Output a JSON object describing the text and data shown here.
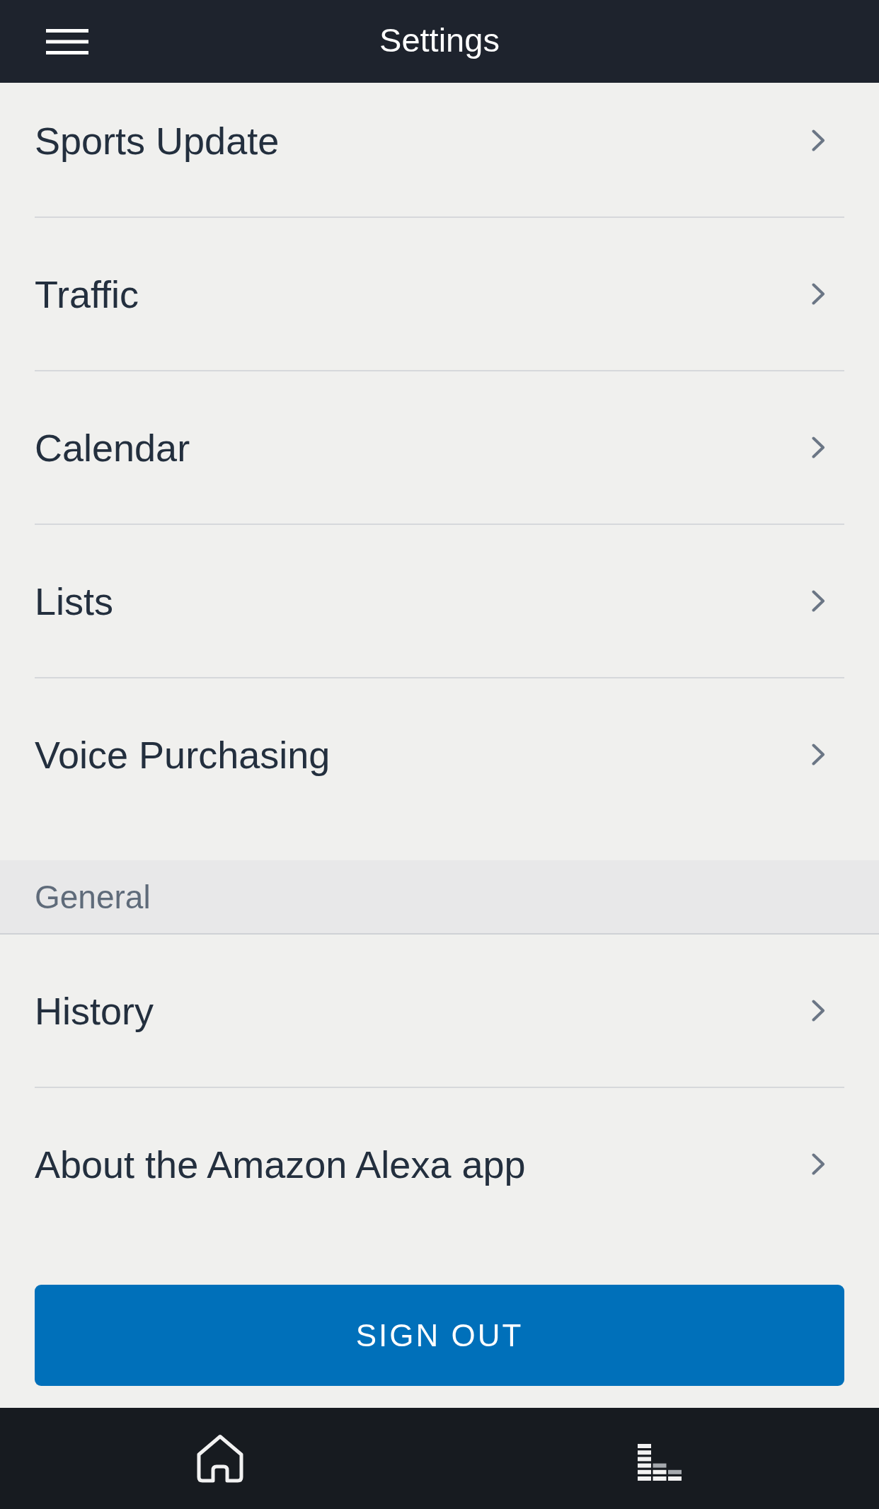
{
  "top_bar": {
    "title": "Settings"
  },
  "sections": [
    {
      "items": [
        {
          "label": "Sports Update"
        },
        {
          "label": "Traffic"
        },
        {
          "label": "Calendar"
        },
        {
          "label": "Lists"
        },
        {
          "label": "Voice Purchasing"
        }
      ]
    },
    {
      "heading": "General",
      "items": [
        {
          "label": "History"
        },
        {
          "label": "About the Amazon Alexa app"
        }
      ]
    }
  ],
  "sign_out_button": {
    "label": "SIGN OUT"
  }
}
